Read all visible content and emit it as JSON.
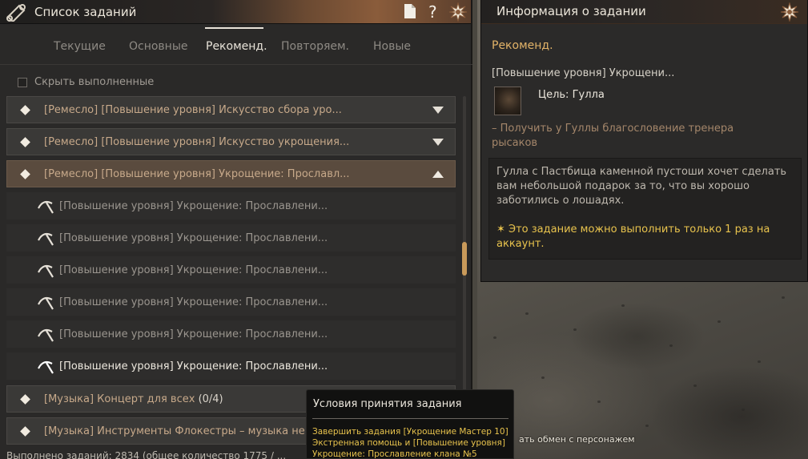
{
  "quest_list": {
    "title": "Список заданий",
    "tabs": [
      {
        "label": "Текущие"
      },
      {
        "label": "Основные"
      },
      {
        "label": "Рекоменд."
      },
      {
        "label": "Повторяем."
      },
      {
        "label": "Новые"
      }
    ],
    "active_tab": "Рекоменд.",
    "hide_completed_label": "Скрыть выполненные",
    "hide_completed_checked": false,
    "categories": [
      {
        "text": "[Ремесло] [Повышение уровня] Искусство сбора уро...",
        "expanded": false
      },
      {
        "text": "[Ремесло] [Повышение уровня] Искусство укрощения...",
        "expanded": false
      },
      {
        "text": "[Ремесло] [Повышение уровня] Укрощение: Прославл...",
        "expanded": true
      },
      {
        "text": "[Музыка] Концерт для всех",
        "count": "(0/4)",
        "expanded": false
      },
      {
        "text": "[Музыка] Инструменты Флокестры – музыка не",
        "expanded": false
      }
    ],
    "subquests": [
      {
        "text": "[Повышение уровня] Укрощение: Прославлени...",
        "highlighted": false
      },
      {
        "text": "[Повышение уровня] Укрощение: Прославлени...",
        "highlighted": false
      },
      {
        "text": "[Повышение уровня] Укрощение: Прославлени...",
        "highlighted": false
      },
      {
        "text": "[Повышение уровня] Укрощение: Прославлени...",
        "highlighted": false
      },
      {
        "text": "[Повышение уровня] Укрощение: Прославлени...",
        "highlighted": false
      },
      {
        "text": "[Повышение уровня] Укрощение: Прославлени...",
        "highlighted": true
      }
    ],
    "bottom_text": "Выполнено заданий: 2834 (общее количество 1775 / ..."
  },
  "info_panel": {
    "title": "Информация о задании",
    "category": "Рекоменд.",
    "quest_name": "[Повышение уровня] Укрощени...",
    "goal": "Цель: Гулла",
    "objective": "– Получить у Гуллы благословение тренера рысаков",
    "description": "Гулла с Пастбища каменной пустоши хочет сделать вам небольшой подарок за то, что вы хорошо заботились о лошадях.",
    "note": "✶ Это задание можно выполнить только 1 раз на аккаунт."
  },
  "tooltip": {
    "title": "Условия принятия задания",
    "body": "Завершить задания [Укрощение Мастер 10] Экстренная помощь и [Повышение уровня] Укрощение: Прославление клана №5"
  },
  "world_hint": "ать обмен с персонажем",
  "colors": {
    "accent_gold": "#e2b368",
    "note_yellow": "#e8c34d",
    "category_text": "#c7a98a"
  }
}
